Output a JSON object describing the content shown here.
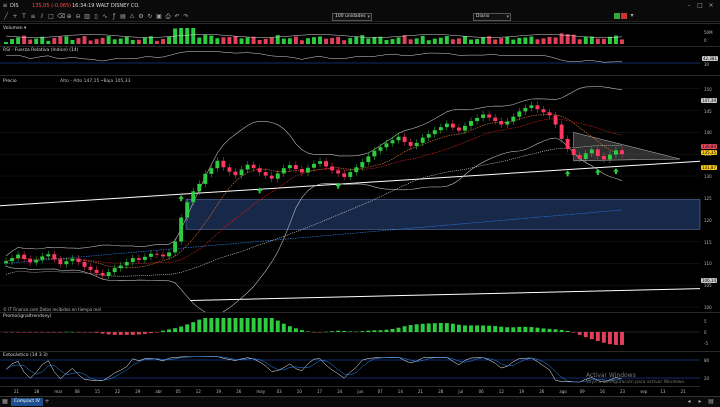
{
  "toolbar": {
    "symbol": "DIS",
    "price_change": "135,05 (-0,065)",
    "time_name": "16:34:19 WALT DISNEY CO.",
    "units_value": "100 unidades",
    "period_value": "Diario"
  },
  "panels": {
    "volume_label": "Volumen ▾",
    "volume_ticks": [
      "50M",
      "0"
    ],
    "rsi_label": "RSI - Fuerza Relativa (Indice) (14)",
    "rsi_ticks": [
      "42,381",
      "30"
    ],
    "price_label": "Precio",
    "price_info": "Alto - Alto 147,15  •Baja 105,33",
    "price_ticks": [
      "150",
      "145",
      "140",
      "135",
      "130",
      "125",
      "120",
      "115",
      "110",
      "105",
      "100"
    ],
    "price_tags": [
      {
        "text": "147,39",
        "color": "#c9c9c9"
      },
      {
        "text": "136,84",
        "color": "#e84a5f"
      },
      {
        "text": "135,35",
        "color": "#f5c518"
      },
      {
        "text": "131,87",
        "color": "#f5c518"
      },
      {
        "text": "106,14",
        "color": "#c9c9c9"
      }
    ],
    "copyright": "© IT Finance.com Datos recibidos en tiempo real",
    "macd_label": "Promo(ignaltrendsey)",
    "macd_ticks": [
      "5",
      "0",
      "-5"
    ],
    "stoch_label": "Estocástico (14 3 3)",
    "stoch_ticks": [
      "80",
      "20"
    ]
  },
  "xaxis": {
    "labels": [
      "21",
      "28",
      "mar",
      "08",
      "15",
      "22",
      "29",
      "abr",
      "05",
      "12",
      "19",
      "26",
      "may",
      "03",
      "10",
      "17",
      "24",
      "jun",
      "07",
      "14",
      "21",
      "28",
      "jul",
      "06",
      "12",
      "19",
      "26",
      "ago",
      "09",
      "16",
      "23",
      "sep",
      "13",
      "21"
    ]
  },
  "watermark": {
    "line1": "Activar Windows",
    "line2": "Vaya a Configuración para activar Windows."
  },
  "statusbar": {
    "tab_label": "Compact IV"
  },
  "chart_data": {
    "type": "candlestick",
    "title": "DIS",
    "ylim": [
      100,
      152
    ],
    "closes": [
      110.5,
      111.2,
      112.0,
      111.0,
      110.2,
      110.8,
      111.6,
      112.1,
      110.9,
      109.8,
      110.5,
      111.1,
      110.3,
      109.2,
      108.5,
      107.8,
      107.2,
      108.0,
      108.9,
      109.5,
      110.3,
      111.2,
      110.8,
      111.5,
      112.2,
      112.0,
      111.6,
      112.5,
      115.0,
      120.5,
      124.0,
      126.5,
      128.2,
      130.5,
      131.8,
      133.5,
      132.0,
      131.0,
      130.2,
      131.5,
      132.6,
      131.8,
      130.9,
      130.1,
      129.4,
      130.6,
      131.8,
      132.5,
      131.6,
      130.8,
      131.9,
      132.8,
      133.4,
      132.2,
      131.3,
      130.6,
      129.8,
      130.9,
      132.0,
      133.2,
      134.5,
      135.8,
      136.6,
      137.5,
      138.2,
      139.0,
      137.8,
      136.9,
      137.6,
      138.8,
      139.6,
      140.5,
      141.2,
      142.0,
      141.1,
      140.4,
      141.5,
      142.6,
      143.3,
      144.1,
      143.4,
      142.6,
      141.8,
      142.5,
      143.6,
      144.8,
      145.6,
      146.2,
      145.3,
      144.6,
      143.9,
      141.8,
      138.5,
      136.2,
      134.8,
      133.9,
      135.2,
      136.1,
      134.6,
      133.8,
      134.9,
      135.9,
      135.05
    ],
    "indicators": [
      "Bollinger Bands",
      "Moving Average",
      "MACD",
      "Stochastic",
      "RSI",
      "Volume"
    ]
  }
}
